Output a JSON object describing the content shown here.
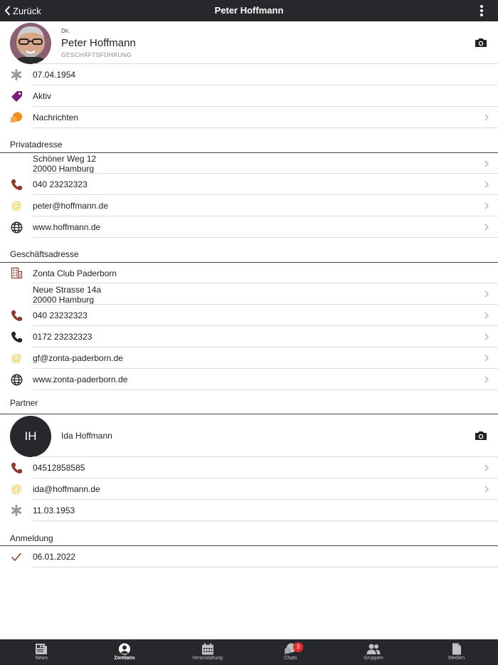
{
  "header": {
    "back_label": "Zurück",
    "title": "Peter Hoffmann"
  },
  "profile": {
    "prefix": "Dr.",
    "name": "Peter Hoffmann",
    "role": "GESCHÄFTSFÜHRUNG",
    "birthdate": "07.04.1954",
    "status": "Aktiv",
    "messages": "Nachrichten"
  },
  "private": {
    "section_label": "Privatadresse",
    "street": "Schöner Weg 12",
    "city": "20000 Hamburg",
    "phone": "040 23232323",
    "email": "peter@hoffmann.de",
    "web": "www.hoffmann.de"
  },
  "business": {
    "section_label": "Geschäftsadresse",
    "company": "Zonta Club Paderborn",
    "street": "Neue Strasse 14a",
    "city": "20000 Hamburg",
    "phone": "040 23232323",
    "mobile": "0172 23232323",
    "email": "gf@zonta-paderborn.de",
    "web": "www.zonta-paderborn.de"
  },
  "partner": {
    "section_label": "Partner",
    "initials": "IH",
    "name": "Ida Hoffmann",
    "phone": "04512858585",
    "email": "ida@hoffmann.de",
    "birthdate": "11.03.1953"
  },
  "registration": {
    "section_label": "Anmeldung",
    "date": "06.01.2022"
  },
  "tabs": [
    {
      "label": "News",
      "icon": "news-icon"
    },
    {
      "label": "Zontians",
      "icon": "person-icon"
    },
    {
      "label": "Veranstaltung",
      "icon": "calendar-icon"
    },
    {
      "label": "Chats",
      "icon": "chat-icon",
      "badge": "3"
    },
    {
      "label": "Gruppen",
      "icon": "group-icon"
    },
    {
      "label": "Medien",
      "icon": "document-icon"
    }
  ],
  "colors": {
    "topbar": "#26282c",
    "phone": "#8b3a2a",
    "email": "#f0c419",
    "tag": "#7b1e7a",
    "chat": "#f28c1b",
    "badge": "#e02d2d"
  }
}
